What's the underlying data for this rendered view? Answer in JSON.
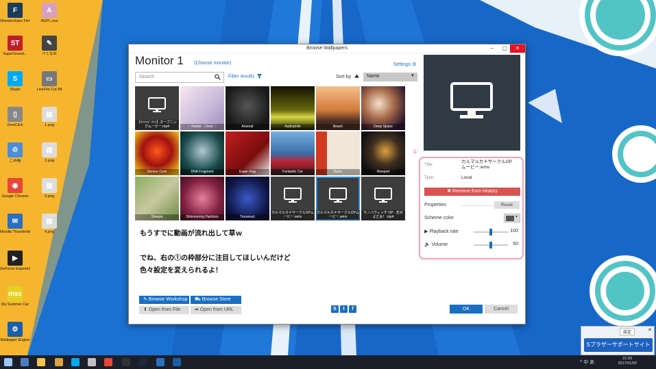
{
  "desktop": {
    "icons": [
      {
        "label": "Wondershare Filmora",
        "color": "#1c3b5a",
        "glyph": "F"
      },
      {
        "label": "AGPL.exe",
        "color": "#d8a0c0",
        "glyph": "A"
      },
      {
        "label": "SuperSound...",
        "color": "#c0202a",
        "glyph": "ST"
      },
      {
        "label": "ぺてなお",
        "color": "#444",
        "glyph": "✎"
      },
      {
        "label": "Skype",
        "color": "#00a9f0",
        "glyph": "S"
      },
      {
        "label": "LiveFile Cut Mt",
        "color": "#777",
        "glyph": "▭"
      },
      {
        "label": "ZeroClick",
        "color": "#888",
        "glyph": "▯"
      },
      {
        "label": "1.png",
        "color": "#ddd",
        "glyph": "▤"
      },
      {
        "label": "ごみ箱",
        "color": "#4b8fd6",
        "glyph": "♲"
      },
      {
        "label": "2.png",
        "color": "#ddd",
        "glyph": "▤"
      },
      {
        "label": "Google Chrome",
        "color": "#e5473a",
        "glyph": "◉"
      },
      {
        "label": "3.png",
        "color": "#ddd",
        "glyph": "▤"
      },
      {
        "label": "Mozilla Thunderbird",
        "color": "#2a6fc2",
        "glyph": "✉"
      },
      {
        "label": "4.png",
        "color": "#ddd",
        "glyph": "▤"
      },
      {
        "label": "GeForce Experience",
        "color": "#222",
        "glyph": "▶"
      },
      {
        "label": "My Summer Car",
        "color": "#e5d020",
        "glyph": "msc"
      },
      {
        "label": "Wallpaper Engine",
        "color": "#1b5fa8",
        "glyph": "⚙"
      }
    ]
  },
  "window": {
    "title": "Browse Wallpapers",
    "minimize": "–",
    "maximize": "▢",
    "close": "✕"
  },
  "header": {
    "monitor_title": "Monitor 1",
    "choose_monitor": "(Choose monitor)",
    "settings": "Settings ⚙"
  },
  "toolbar": {
    "search_placeholder": "Search",
    "filter": "Filter results",
    "sort_by": "Sort by",
    "sort_value": "Name",
    "sort_arrow": "▼"
  },
  "tiles": [
    {
      "caption": "【ｲﾄﾒ×ﾄﾞﾒｲﾝ】オープニングムービー.mp4",
      "kind": "monitor"
    },
    {
      "caption": "♡ Rabbit - Clock ♡",
      "kind": "img",
      "bg": "linear-gradient(135deg,#f6e8ef,#c8b6d8 60%,#9c8bb8)"
    },
    {
      "caption": "Arsenal",
      "kind": "img",
      "bg": "radial-gradient(circle at 50% 45%,#555,#1a1a1a 70%)"
    },
    {
      "caption": "Audiophile",
      "kind": "img",
      "bg": "linear-gradient(180deg,#101000,#6a6a10 55%,#d8d840 70%,#1a1a00)"
    },
    {
      "caption": "Beach",
      "kind": "img",
      "bg": "linear-gradient(180deg,#f3c08a,#d27a3a 55%,#4a2e22 80%)"
    },
    {
      "caption": "Deep Space",
      "kind": "img",
      "bg": "radial-gradient(circle at 40% 40%,#f4e2c8,#a76a4a 40%,#2b1830 80%)"
    },
    {
      "caption": "Demon Core",
      "kind": "img",
      "bg": "radial-gradient(circle at 50% 45%,#ff5a1a,#a01010 45%,#f2c61a 90%)"
    },
    {
      "caption": "DNA Fragment",
      "kind": "img",
      "bg": "radial-gradient(circle at 50% 45%,#b0c8d0,#1a4a4a 60%,#061a1a)"
    },
    {
      "caption": "Eagle Flag",
      "kind": "img",
      "bg": "linear-gradient(135deg,#c02020,#7a0c0c 60%,#f0f0f0)"
    },
    {
      "caption": "Fantastic Car",
      "kind": "img",
      "bg": "linear-gradient(180deg,#7ab0e0,#3a6ea8 50%,#c02030 70%,#202020)"
    },
    {
      "caption": "Retro",
      "kind": "img",
      "bg": "linear-gradient(90deg,#d03a20 25%,#f2e6d8 25%)"
    },
    {
      "caption": "Risepod",
      "kind": "img",
      "bg": "radial-gradient(circle at 55% 45%,#e0a040,#403020 40%,#0c0c10 80%)"
    },
    {
      "caption": "Sheeps",
      "kind": "img",
      "bg": "linear-gradient(135deg,#8ab060,#c8c8a0 50%,#6a8a40)"
    },
    {
      "caption": "Shimmering Particles",
      "kind": "img",
      "bg": "radial-gradient(circle at 50% 50%,#e880a0,#802040 60%,#401020)"
    },
    {
      "caption": "Tesseract",
      "kind": "img",
      "bg": "radial-gradient(circle at 50% 50%,#3a5ac8,#101848 65%,#080820)"
    },
    {
      "caption": "カルマルカ＊サークルOPムービー.wmv",
      "kind": "monitor"
    },
    {
      "caption": "カルマルカ＊サークルOPムービー.wmv",
      "kind": "monitor",
      "selected": true
    },
    {
      "caption": "サノバウィッチ OP - 恋せよ乙女！.mp4",
      "kind": "monitor"
    }
  ],
  "message": {
    "line1": "もうすでに動画が流れ出して草ｗ",
    "line2": "でね、右の①の枠部分に注目してほしいんだけど",
    "line3": "色々設定を変えられるよ！"
  },
  "bottom": {
    "browse_workshop": "✎ Browse Workshop",
    "browse_store": "⛟ Browse Store",
    "open_file": "⬆ Open from File",
    "open_url": "➦ Open from URL",
    "ok": "OK",
    "cancel": "Cancel",
    "social": [
      "S",
      "t",
      "f"
    ]
  },
  "panel": {
    "annotation": "①",
    "title_label": "Title:",
    "title_value": "カルマルカ＊サークルOPムービー.wmv",
    "type_label": "Type:",
    "type_value": "Local",
    "remove": "✖ Remove from History",
    "properties": "Properties",
    "reset": "Reset",
    "scheme_color": "Scheme color",
    "scheme_color_value": "#555555",
    "playback_label": "▶  Playback rate",
    "playback_value": "100",
    "playback_level": 0.5,
    "volume_label": "🔈 Volume",
    "volume_value": "50",
    "volume_level": 0.5
  },
  "popup": {
    "tab": "設定",
    "close": "✕",
    "button": "Sブラザーサポートサイト"
  },
  "taskbar": {
    "tray": "^ 中 あ",
    "time": "21:59",
    "date": "2017/01/02",
    "icons": [
      "windows-start",
      "pin-app",
      "folder",
      "file-manager",
      "skype",
      "settings-app",
      "chrome",
      "game",
      "steam",
      "mail",
      "wallpaper-engine"
    ]
  }
}
